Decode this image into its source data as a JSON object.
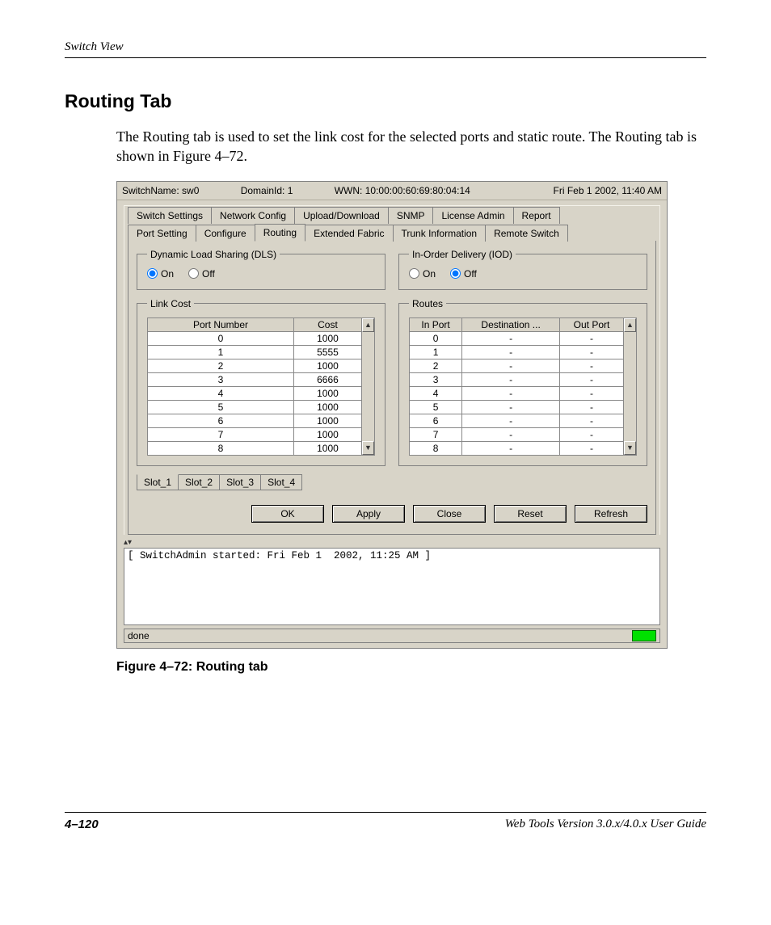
{
  "doc": {
    "running_head": "Switch View",
    "section_title": "Routing Tab",
    "body_text": "The Routing tab is used to set the link cost for the selected ports and static route. The Routing tab is shown in Figure 4–72.",
    "figure_caption": "Figure 4–72:  Routing tab",
    "page_number": "4–120",
    "guide_title": "Web Tools Version 3.0.x/4.0.x User Guide"
  },
  "dialog": {
    "header": {
      "switch_name_label": "SwitchName: sw0",
      "domain_label": "DomainId: 1",
      "wwn_label": "WWN: 10:00:00:60:69:80:04:14",
      "timestamp": "Fri Feb 1  2002, 11:40 AM"
    },
    "tabs_row1": [
      "Switch Settings",
      "Network Config",
      "Upload/Download",
      "SNMP",
      "License Admin",
      "Report"
    ],
    "tabs_row2": [
      "Port Setting",
      "Configure",
      "Routing",
      "Extended Fabric",
      "Trunk Information",
      "Remote Switch"
    ],
    "active_tab": "Routing",
    "dls": {
      "legend": "Dynamic Load Sharing (DLS)",
      "on_label": "On",
      "off_label": "Off",
      "value": "On"
    },
    "iod": {
      "legend": "In-Order Delivery (IOD)",
      "on_label": "On",
      "off_label": "Off",
      "value": "Off"
    },
    "link_cost": {
      "legend": "Link Cost",
      "columns": [
        "Port Number",
        "Cost"
      ],
      "rows": [
        {
          "port": "0",
          "cost": "1000"
        },
        {
          "port": "1",
          "cost": "5555"
        },
        {
          "port": "2",
          "cost": "1000"
        },
        {
          "port": "3",
          "cost": "6666"
        },
        {
          "port": "4",
          "cost": "1000"
        },
        {
          "port": "5",
          "cost": "1000"
        },
        {
          "port": "6",
          "cost": "1000"
        },
        {
          "port": "7",
          "cost": "1000"
        },
        {
          "port": "8",
          "cost": "1000"
        }
      ]
    },
    "routes": {
      "legend": "Routes",
      "columns": [
        "In Port",
        "Destination ...",
        "Out Port"
      ],
      "rows": [
        {
          "in": "0",
          "dest": "-",
          "out": "-"
        },
        {
          "in": "1",
          "dest": "-",
          "out": "-"
        },
        {
          "in": "2",
          "dest": "-",
          "out": "-"
        },
        {
          "in": "3",
          "dest": "-",
          "out": "-"
        },
        {
          "in": "4",
          "dest": "-",
          "out": "-"
        },
        {
          "in": "5",
          "dest": "-",
          "out": "-"
        },
        {
          "in": "6",
          "dest": "-",
          "out": "-"
        },
        {
          "in": "7",
          "dest": "-",
          "out": "-"
        },
        {
          "in": "8",
          "dest": "-",
          "out": "-"
        }
      ]
    },
    "slot_tabs": [
      "Slot_1",
      "Slot_2",
      "Slot_3",
      "Slot_4"
    ],
    "active_slot": "Slot_1",
    "buttons": {
      "ok": "OK",
      "apply": "Apply",
      "close": "Close",
      "reset": "Reset",
      "refresh": "Refresh"
    },
    "log_text": "[ SwitchAdmin started: Fri Feb 1  2002, 11:25 AM ]",
    "status_text": "done"
  }
}
